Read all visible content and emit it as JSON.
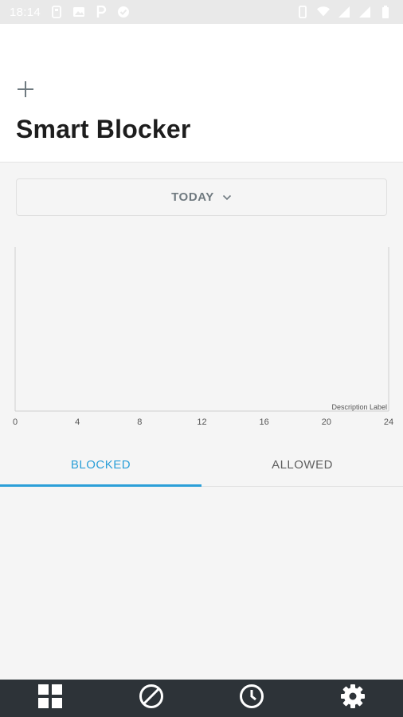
{
  "status_bar": {
    "time": "18:14",
    "left_icons": [
      "notification-icon",
      "image-icon",
      "parking-icon",
      "shield-check-icon"
    ],
    "right_icons": [
      "vibrate-icon",
      "wifi-icon",
      "signal-icon",
      "signal-icon",
      "battery-icon"
    ]
  },
  "header": {
    "add_icon": "plus-icon",
    "title": "Smart Blocker"
  },
  "period_selector": {
    "label": "TODAY",
    "icon": "chevron-down-icon"
  },
  "chart_data": {
    "type": "line",
    "x": [
      0,
      4,
      8,
      12,
      16,
      20,
      24
    ],
    "xlim": [
      0,
      24
    ],
    "x_tick_labels": [
      "0",
      "4",
      "8",
      "12",
      "16",
      "20",
      "24"
    ],
    "series": [],
    "description_label": "Description Label",
    "grid": false
  },
  "tabs": [
    {
      "label": "BLOCKED",
      "active": true
    },
    {
      "label": "ALLOWED",
      "active": false
    }
  ],
  "bottom_nav": [
    {
      "icon": "dashboard-grid-icon"
    },
    {
      "icon": "block-icon"
    },
    {
      "icon": "clock-icon"
    },
    {
      "icon": "gear-icon"
    }
  ],
  "colors": {
    "accent": "#2b9fd8",
    "bottom_nav_bg": "#2d3338",
    "background": "#f5f5f5",
    "header_bg": "#ffffff"
  }
}
